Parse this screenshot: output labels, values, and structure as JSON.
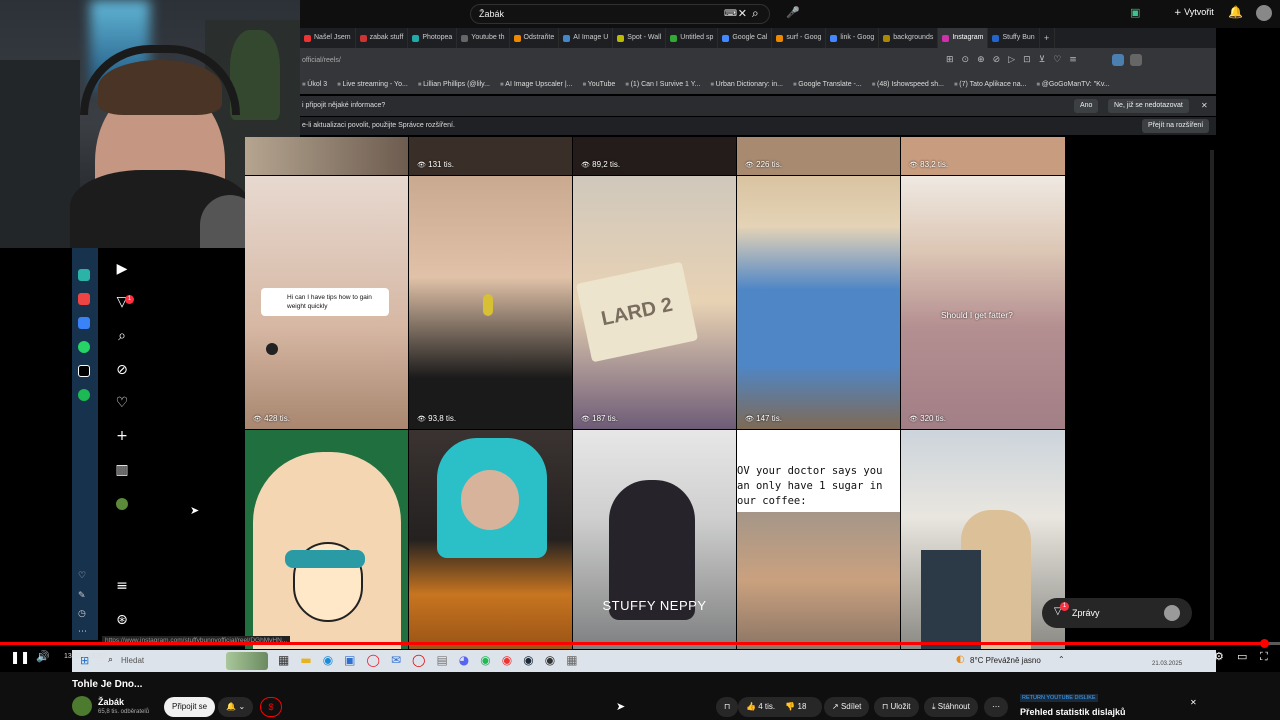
{
  "youtube_header": {
    "search_value": "Žabák",
    "create_label": "Vytvořit"
  },
  "browser": {
    "tabs": [
      "Našel Jsem",
      "zabak stuff",
      "Photopea",
      "Youtube th",
      "Odstraňte",
      "AI Image U",
      "Spot - Wall",
      "Untitled sp",
      "Google Cal",
      "surf - Goog",
      "link - Goog",
      "backgrounds",
      "Instagram",
      "Stuffy Bun"
    ],
    "active_tab_index": 12,
    "url": "official/reels/",
    "bookmarks": [
      "Úkol 3",
      "Live streaming - Yo...",
      "Lillian Phillips (@lily...",
      "AI Image Upscaler |...",
      "YouTube",
      "(1) Can I Survive 1 Y...",
      "Urban Dictionary: in...",
      "Google Translate -...",
      "(48) Ishowspeed sh...",
      "(7) Tato Aplikace na...",
      "@GoGoManTV: \"Kv..."
    ],
    "infobar1_text": "i připojit nějaké informace?",
    "infobar1_yes": "Ano",
    "infobar1_no": "Ne, již se nedotazovat",
    "infobar2_text": "e-li aktualizaci povolit, použijte Správce rozšíření.",
    "infobar2_button": "Přejít na rozšíření"
  },
  "instagram": {
    "top_views": [
      "131 tis.",
      "89,2 tis.",
      "226 tis.",
      "83,2 tis."
    ],
    "row1": [
      {
        "views": "428 tis.",
        "overlay": "Hi can I have tips how to gain weight quickly"
      },
      {
        "views": "93,8 tis.",
        "overlay": ""
      },
      {
        "views": "187 tis.",
        "overlay": "LARD 2"
      },
      {
        "views": "147 tis.",
        "overlay": ""
      },
      {
        "views": "320 tis.",
        "overlay": "Should I get fatter?"
      }
    ],
    "row2_overlays": [
      "",
      "",
      "STUFFY NEPPY",
      "OV your doctor says you an only have 1 sugar in our coffee:",
      ""
    ],
    "messages_label": "Zprávy",
    "messages_badge": "1",
    "notif_badge": "1",
    "status_url": "https://www.instagram.com/stuffybunnyofficial/reel/DGhMyHN..."
  },
  "taskbar": {
    "search_placeholder": "Hledat",
    "weather": "8°C  Převážně jasno",
    "date": "21.03.2025"
  },
  "player": {
    "time": "13:38 / 13:50",
    "progress": 0.985
  },
  "video": {
    "title": "Tohle Je Dno...",
    "channel": "Žabák",
    "subscribers": "65,8 tis. odběratelů",
    "join_label": "Připojit se",
    "likes": "4 tis.",
    "dislikes": "18",
    "share_label": "Sdílet",
    "save_label": "Uložit",
    "download_label": "Stáhnout",
    "ryd_badge": "RETURN YOUTUBE DISLIKE",
    "ryd_text": "Přehled statistik dislajků"
  },
  "colors": {
    "accent_red": "#ff0000",
    "instagram_bg": "#000000",
    "ext_strip": "#17324d"
  }
}
